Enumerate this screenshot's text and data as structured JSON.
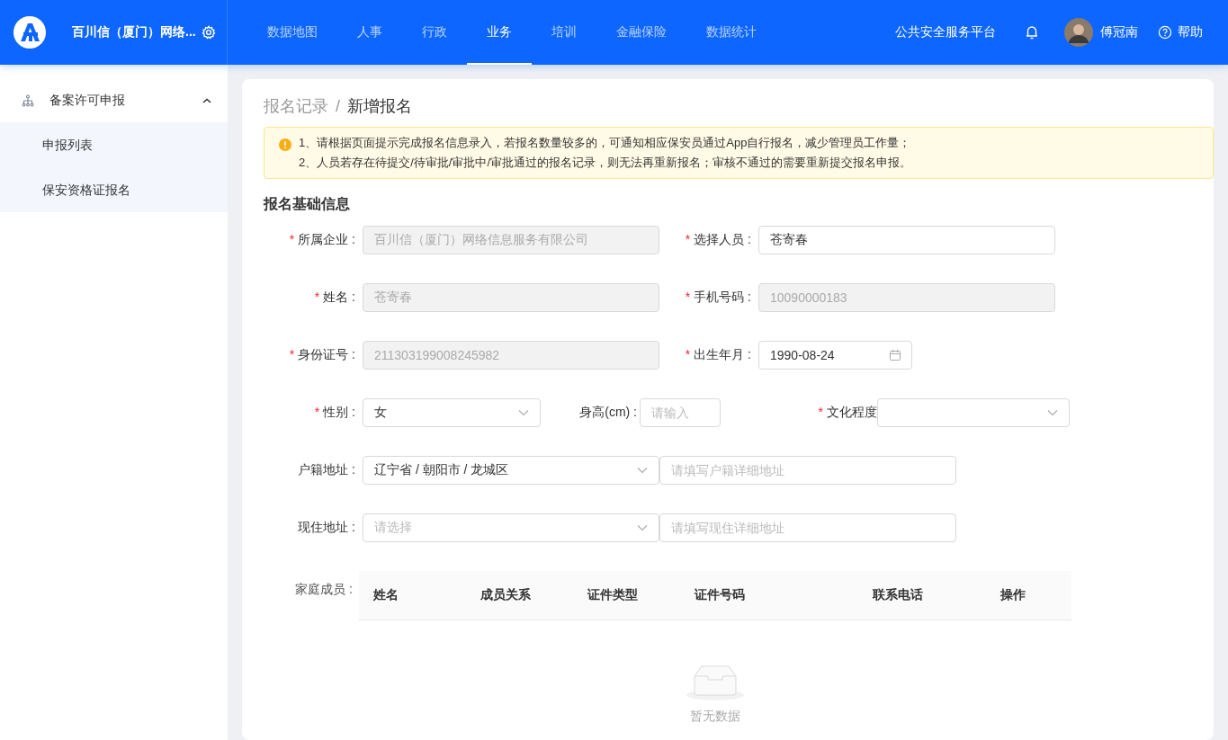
{
  "header": {
    "brand": "百川信（厦门）网络...",
    "nav": [
      {
        "label": "数据地图",
        "selected": false
      },
      {
        "label": "人事",
        "selected": false
      },
      {
        "label": "行政",
        "selected": false
      },
      {
        "label": "业务",
        "selected": true
      },
      {
        "label": "培训",
        "selected": false
      },
      {
        "label": "金融保险",
        "selected": false
      },
      {
        "label": "数据统计",
        "selected": false
      }
    ],
    "platform": "公共安全服务平台",
    "user": "傅冠南",
    "help": "帮助"
  },
  "sidebar": {
    "items": [
      {
        "label": "备案许可申报",
        "expanded": true,
        "children": [
          {
            "label": "申报列表"
          },
          {
            "label": "保安资格证报名"
          }
        ]
      }
    ]
  },
  "breadcrumb": {
    "items": [
      "报名记录",
      "新增报名"
    ],
    "separator": "/"
  },
  "alert": {
    "lines": [
      "1、请根据页面提示完成报名信息录入，若报名数量较多的，可通知相应保安员通过App自行报名，减少管理员工作量；",
      "2、人员若存在待提交/待审批/审批中/审批通过的报名记录，则无法再重新报名；审核不通过的需要重新提交报名申报。"
    ]
  },
  "section_title": "报名基础信息",
  "form": {
    "rows": [
      [
        {
          "asterisk": "*",
          "label": "所属企业 :",
          "kind": "input",
          "value": "百川信（厦门）网络信息服务有限公司",
          "disabled": true
        },
        {
          "asterisk": "*",
          "label": "选择人员 :",
          "kind": "input",
          "value": "苍寄春",
          "disabled": false
        }
      ],
      [
        {
          "asterisk": "*",
          "label": "姓名 :",
          "kind": "input",
          "value": "苍寄春",
          "disabled": true
        },
        {
          "asterisk": "*",
          "label": "手机号码 :",
          "kind": "input",
          "value": "10090000183",
          "disabled": true
        }
      ],
      [
        {
          "asterisk": "*",
          "label": "身份证号 :",
          "kind": "input",
          "value": "211303199008245982",
          "disabled": true
        },
        {
          "asterisk": "*",
          "label": "出生年月 :",
          "kind": "date",
          "value": "1990-08-24",
          "disabled": false
        }
      ],
      [
        {
          "asterisk": "*",
          "label": "性别 :",
          "kind": "select",
          "value": "女",
          "disabled": false
        },
        {
          "label": "身高(cm) :",
          "kind": "input",
          "placeholder": "请输入",
          "disabled": false
        },
        {
          "asterisk": "*",
          "label": "文化程度",
          "kind": "select",
          "disabled": false
        }
      ],
      [
        {
          "label": "户籍地址 :",
          "kind": "select",
          "value": "辽宁省 / 朝阳市 / 龙城区",
          "disabled": false
        },
        {
          "kind": "input",
          "placeholder": "请填写户籍详细地址",
          "disabled": false
        }
      ],
      [
        {
          "label": "现住地址 :",
          "kind": "select",
          "placeholder": "请选择",
          "disabled": false
        },
        {
          "kind": "input",
          "placeholder": "请填写现住详细地址",
          "disabled": false
        }
      ]
    ]
  },
  "family": {
    "label": "家庭成员 :",
    "columns": [
      "姓名",
      "成员关系",
      "证件类型",
      "证件号码",
      "联系电话",
      "操作"
    ],
    "empty_text": "暂无数据"
  }
}
